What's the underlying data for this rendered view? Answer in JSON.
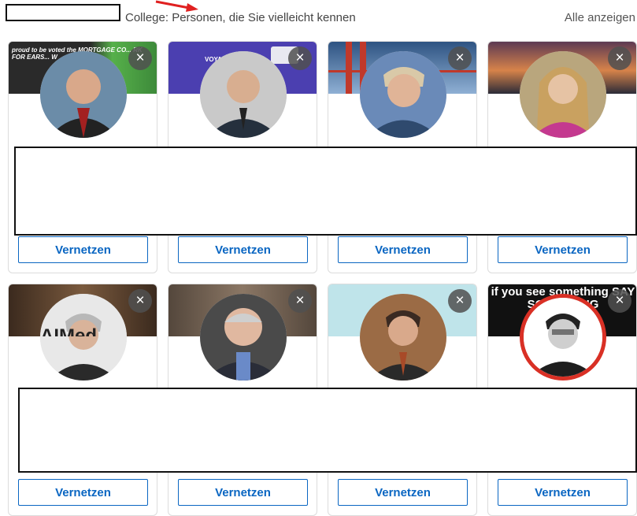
{
  "header": {
    "title": "College: Personen, die Sie vielleicht kennen",
    "see_all": "Alle anzeigen"
  },
  "card_close_label": "×",
  "connect_label": "Vernetzen",
  "cards": [
    {
      "banner_text": "proud to be voted the MORTGAGE CO... RK FOR EARS... W",
      "banner_color": "#2f8f43"
    },
    {
      "banner_text": "VOYAGE NOV",
      "banner_color": "#4b3fb0"
    },
    {
      "banner_text": "",
      "banner_color": "#3b5f8f"
    },
    {
      "banner_text": "",
      "banner_color": "#c8703a"
    },
    {
      "banner_text": "AIMed",
      "banner_color": "#5b4636"
    },
    {
      "banner_text": "",
      "banner_color": "#6b6055"
    },
    {
      "banner_text": "",
      "banner_color": "#bfe4ea"
    },
    {
      "banner_text": "if you see something SAY SOMETHING",
      "banner_color": "#111111"
    }
  ],
  "colors": {
    "accent": "#0a66c2",
    "close_bg": "#505050",
    "highlight_ring": "#d93025",
    "arrow": "#e02020"
  }
}
